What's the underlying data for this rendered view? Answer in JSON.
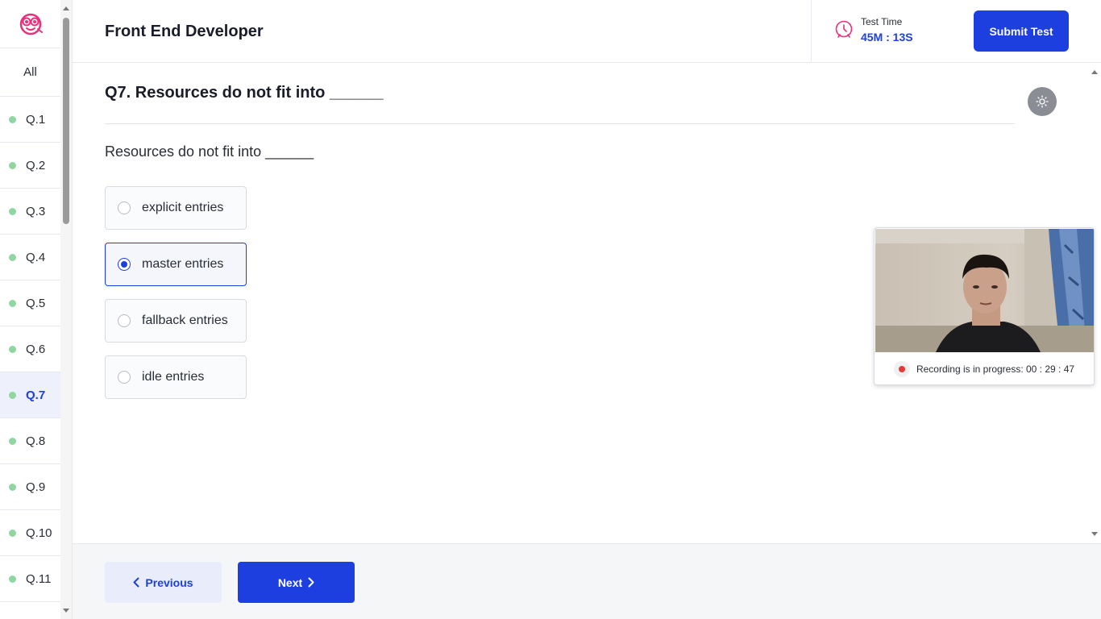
{
  "sidebar": {
    "all_label": "All",
    "questions": [
      {
        "label": "Q.1",
        "active": false
      },
      {
        "label": "Q.2",
        "active": false
      },
      {
        "label": "Q.3",
        "active": false
      },
      {
        "label": "Q.4",
        "active": false
      },
      {
        "label": "Q.5",
        "active": false
      },
      {
        "label": "Q.6",
        "active": false
      },
      {
        "label": "Q.7",
        "active": true
      },
      {
        "label": "Q.8",
        "active": false
      },
      {
        "label": "Q.9",
        "active": false
      },
      {
        "label": "Q.10",
        "active": false
      },
      {
        "label": "Q.11",
        "active": false
      }
    ],
    "answered_dot_color": "#8fd6a2"
  },
  "header": {
    "title": "Front End Developer",
    "timer_label": "Test Time",
    "timer_value": "45M : 13S",
    "submit_label": "Submit Test"
  },
  "question": {
    "title": "Q7. Resources do not fit into ______",
    "text": "Resources do not fit into ______",
    "options": [
      {
        "label": "explicit entries",
        "selected": false
      },
      {
        "label": "master entries",
        "selected": true
      },
      {
        "label": "fallback entries",
        "selected": false
      },
      {
        "label": "idle entries",
        "selected": false
      }
    ]
  },
  "footer": {
    "previous_label": "Previous",
    "next_label": "Next"
  },
  "webcam": {
    "status_text": "Recording is in progress: 00 : 29 : 47"
  },
  "colors": {
    "accent": "#1d3fe0",
    "logo": "#e8317a",
    "recording": "#e53935"
  }
}
